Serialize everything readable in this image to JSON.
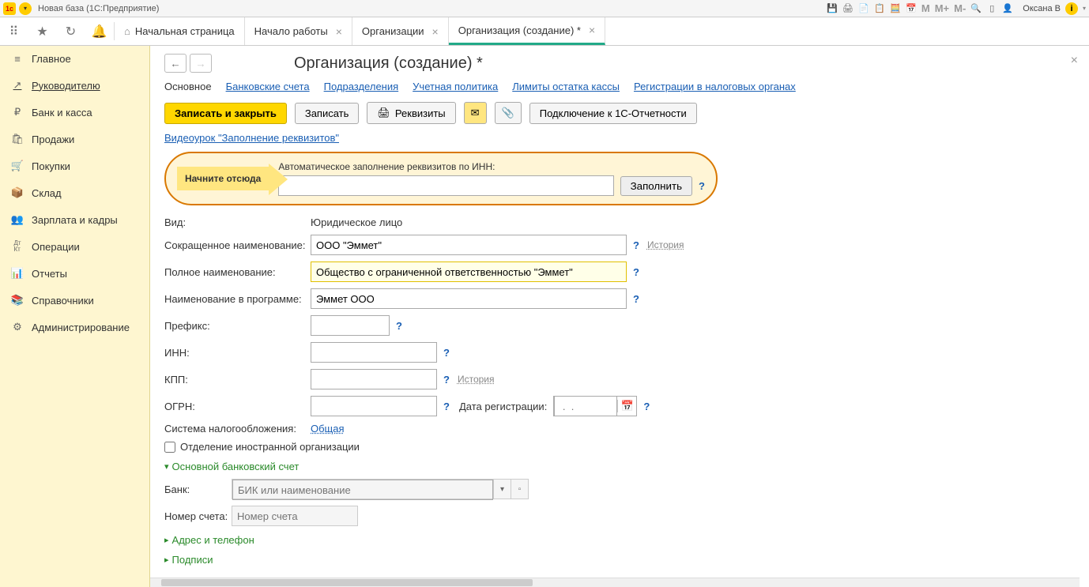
{
  "titlebar": {
    "title": "Новая база  (1С:Предприятие)",
    "user": "Оксана В",
    "m_buttons": [
      "M",
      "M+",
      "M-"
    ]
  },
  "tabs": {
    "home": "Начальная страница",
    "items": [
      {
        "label": "Начало работы"
      },
      {
        "label": "Организации"
      },
      {
        "label": "Организация (создание) *",
        "active": true
      }
    ]
  },
  "sidebar": {
    "items": [
      {
        "icon": "≡",
        "label": "Главное"
      },
      {
        "icon": "↗",
        "label": "Руководителю",
        "underline": true
      },
      {
        "icon": "₽",
        "label": "Банк и касса"
      },
      {
        "icon": "🛍",
        "label": "Продажи"
      },
      {
        "icon": "🛒",
        "label": "Покупки"
      },
      {
        "icon": "📦",
        "label": "Склад"
      },
      {
        "icon": "👥",
        "label": "Зарплата и кадры"
      },
      {
        "icon": "Дт/Кт",
        "label": "Операции"
      },
      {
        "icon": "📊",
        "label": "Отчеты"
      },
      {
        "icon": "📚",
        "label": "Справочники"
      },
      {
        "icon": "⚙",
        "label": "Администрирование"
      }
    ]
  },
  "page": {
    "title": "Организация (создание) *",
    "subtabs": [
      "Основное",
      "Банковские счета",
      "Подразделения",
      "Учетная политика",
      "Лимиты остатка кассы",
      "Регистрации в налоговых органах"
    ],
    "buttons": {
      "save_close": "Записать и закрыть",
      "save": "Записать",
      "requisites": "Реквизиты",
      "connect": "Подключение к 1С-Отчетности"
    },
    "video_link": "Видеоурок \"Заполнение реквизитов\"",
    "callout": {
      "start": "Начните отсюда",
      "label": "Автоматическое заполнение реквизитов по ИНН:",
      "fill": "Заполнить"
    },
    "form": {
      "type_label": "Вид:",
      "type_value": "Юридическое лицо",
      "short_name_label": "Сокращенное наименование:",
      "short_name_value": "ООО \"Эммет\"",
      "full_name_label": "Полное наименование:",
      "full_name_value": "Общество с ограниченной ответственностью \"Эммет\"",
      "prog_name_label": "Наименование в программе:",
      "prog_name_value": "Эммет ООО",
      "prefix_label": "Префикс:",
      "inn_label": "ИНН:",
      "kpp_label": "КПП:",
      "ogrn_label": "ОГРН:",
      "reg_date_label": "Дата регистрации:",
      "reg_date_placeholder": " .  .    ",
      "tax_label": "Система налогообложения:",
      "tax_value": "Общая",
      "foreign_label": "Отделение иностранной организации",
      "history": "История",
      "help": "?"
    },
    "sections": {
      "bank": "Основной банковский счет",
      "bank_label": "Банк:",
      "bank_placeholder": "БИК или наименование",
      "account_label": "Номер счета:",
      "account_placeholder": "Номер счета",
      "address": "Адрес и телефон",
      "signatures": "Подписи"
    }
  }
}
